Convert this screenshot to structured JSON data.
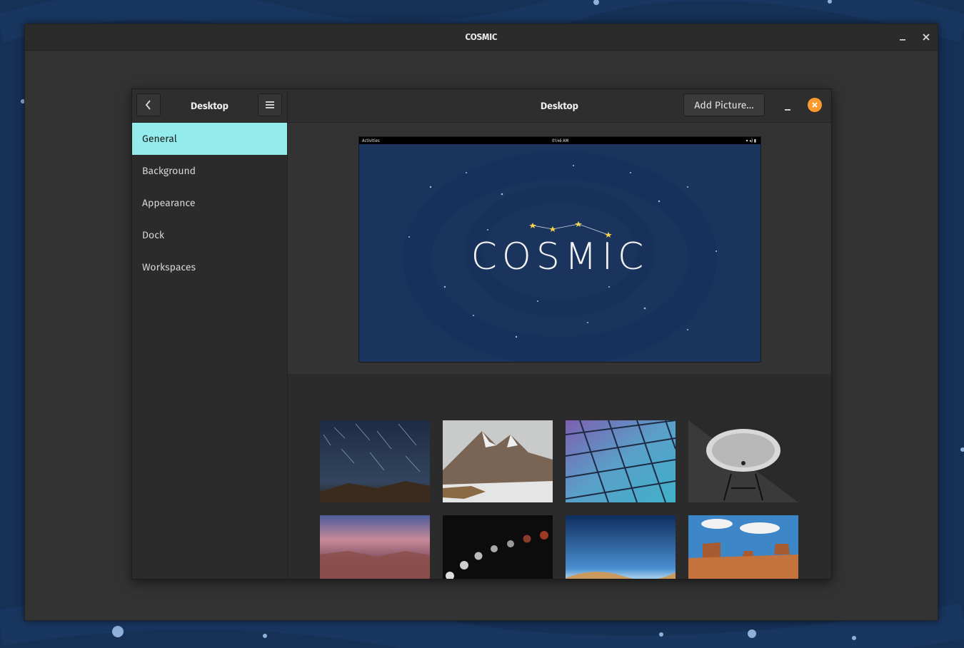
{
  "outer_window": {
    "title": "COSMIC"
  },
  "sidebar": {
    "title": "Desktop",
    "items": [
      {
        "label": "General",
        "active": true
      },
      {
        "label": "Background",
        "active": false
      },
      {
        "label": "Appearance",
        "active": false
      },
      {
        "label": "Dock",
        "active": false
      },
      {
        "label": "Workspaces",
        "active": false
      }
    ]
  },
  "main": {
    "title": "Desktop",
    "add_button": "Add Picture…"
  },
  "preview": {
    "topbar_left": "Activities",
    "topbar_center": "01:46 AM",
    "logo_text": "COSMIC"
  },
  "wallpapers": [
    {
      "name": "star-trails"
    },
    {
      "name": "snowy-mountains"
    },
    {
      "name": "geometric-glass-ceiling"
    },
    {
      "name": "radio-telescope-dish"
    },
    {
      "name": "canyon-sunset"
    },
    {
      "name": "lunar-eclipse-sequence"
    },
    {
      "name": "desert-dunes-blue-sky"
    },
    {
      "name": "monument-valley"
    }
  ],
  "colors": {
    "accent": "#94ebeb",
    "close_button": "#fb9b2b",
    "desktop_bg": "#163056"
  },
  "icons": {
    "back": "chevron-left-icon",
    "menu": "hamburger-menu-icon",
    "minimize": "minimize-icon",
    "close": "close-icon"
  }
}
